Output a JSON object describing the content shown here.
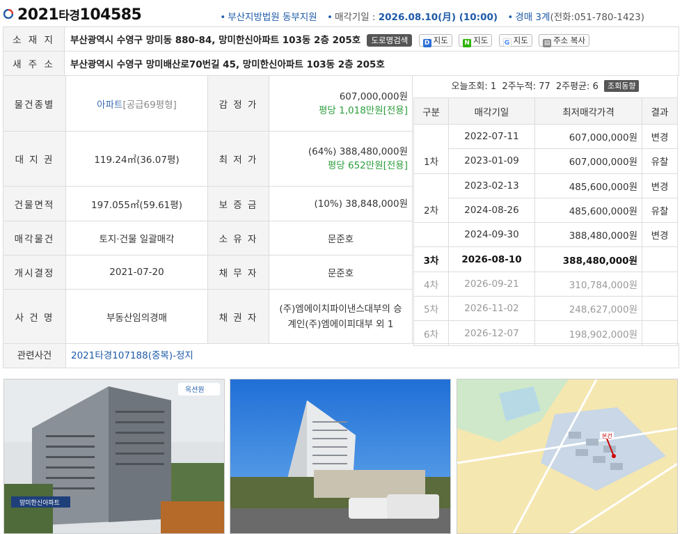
{
  "header": {
    "case_year": "2021",
    "case_type": "타경",
    "case_number": "104585",
    "court": "부산지방법원 동부지원",
    "sale_date_label": "매각기일 : ",
    "sale_date": "2026.08.10(月) (10:00)",
    "dept": "경매 3계",
    "phone": "(전화:051-780-1423)"
  },
  "address": {
    "label": "소 재 지",
    "value": "부산광역시 수영구 망미동 880-84, 망미한신아파트 103동 2층 205호",
    "buttons": [
      "도로명검색",
      "지도",
      "지도",
      "지도",
      "주소 복사"
    ],
    "new_label": "새 주 소",
    "new_value": "부산광역시 수영구 망미배산로70번길 45, 망미한신아파트 103동 2층 205호"
  },
  "details": {
    "type_label": "물건종별",
    "type_value": "아파트",
    "type_note": "[공급69평형]",
    "appraisal_label": "감 정 가",
    "appraisal_value": "607,000,000원",
    "appraisal_per": "평당 1,018만원[전용]",
    "land_label": "대 지 권",
    "land_value": "119.24㎡(36.07평)",
    "min_label": "최 저 가",
    "min_value": "(64%) 388,480,000원",
    "min_per": "평당 652만원[전용]",
    "bldg_label": "건물면적",
    "bldg_value": "197.055㎡(59.61평)",
    "deposit_label": "보 증 금",
    "deposit_value": "(10%) 38,848,000원",
    "sale_obj_label": "매각물건",
    "sale_obj_value": "토지·건물 일괄매각",
    "owner_label": "소 유 자",
    "owner_value": "문준호",
    "start_label": "개시결정",
    "start_value": "2021-07-20",
    "debtor_label": "채 무 자",
    "debtor_value": "문준호",
    "case_name_label": "사 건 명",
    "case_name_value": "부동산임의경매",
    "creditor_label": "채 권 자",
    "creditor_value": "(주)엠에이치파이낸스대부의 승계인(주)엠에이피대부 외 1",
    "related_label": "관련사건",
    "related_value": "2021타경107188(중복)-정지"
  },
  "views": {
    "today": "오늘조회: 1",
    "two_week": "2주누적: 77",
    "avg": "2주평균: 6",
    "badge": "조회동향"
  },
  "history": {
    "headers": [
      "구분",
      "매각기일",
      "최저매각가격",
      "결과"
    ],
    "rows": [
      {
        "round": "",
        "date": "2022-07-11",
        "price": "607,000,000원",
        "result": "변경"
      },
      {
        "round": "1차",
        "date": "2023-01-09",
        "price": "607,000,000원",
        "result": "유찰"
      },
      {
        "round": "",
        "date": "2023-02-13",
        "price": "485,600,000원",
        "result": "변경"
      },
      {
        "round": "2차",
        "date": "2024-08-26",
        "price": "485,600,000원",
        "result": "유찰"
      },
      {
        "round": "",
        "date": "2024-09-30",
        "price": "388,480,000원",
        "result": "변경"
      },
      {
        "round": "3차",
        "date": "2026-08-10",
        "price": "388,480,000원",
        "result": ""
      },
      {
        "round": "4차",
        "date": "2026-09-21",
        "price": "310,784,000원",
        "result": ""
      },
      {
        "round": "5차",
        "date": "2026-11-02",
        "price": "248,627,000원",
        "result": ""
      },
      {
        "round": "6차",
        "date": "2026-12-07",
        "price": "198,902,000원",
        "result": ""
      }
    ]
  },
  "photos": {
    "photo1_badge": "옥션원",
    "photo1_sign": "망미한신아파트",
    "photo3_tag": "본건"
  }
}
